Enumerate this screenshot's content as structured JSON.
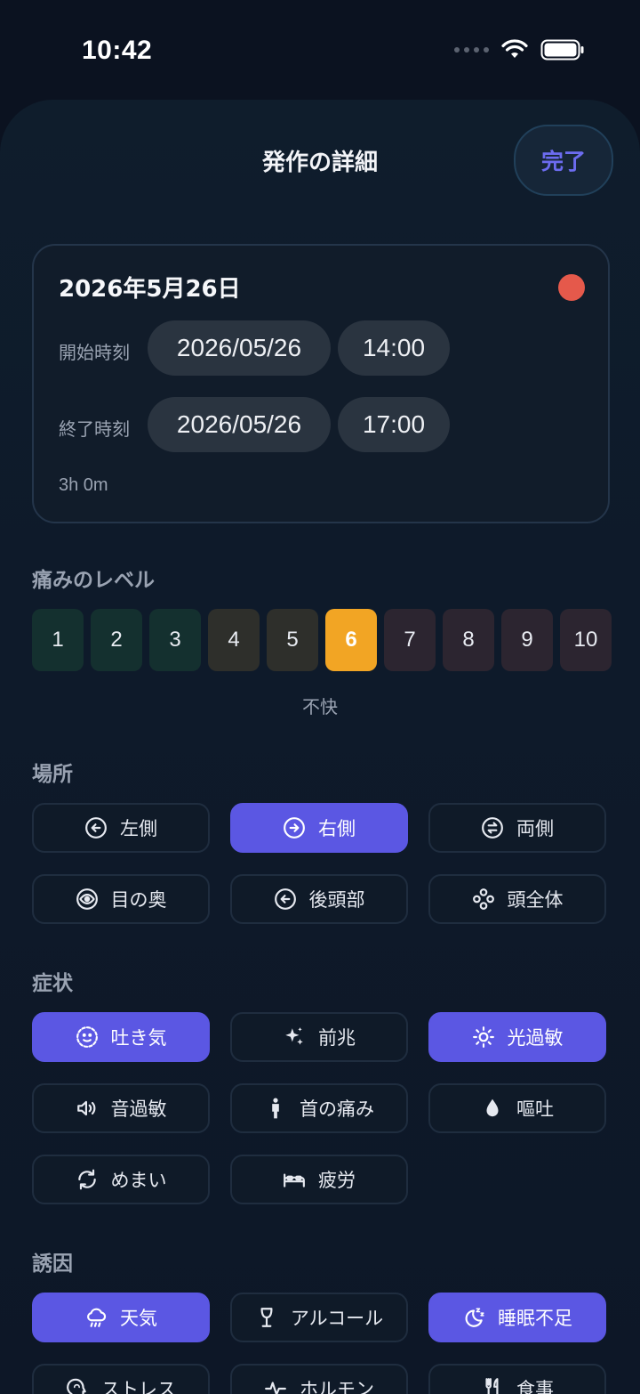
{
  "status_bar": {
    "time": "10:42"
  },
  "header": {
    "title": "発作の詳細",
    "done_label": "完了"
  },
  "episode": {
    "date_title": "2026年5月26日",
    "start_label": "開始時刻",
    "start_date": "2026/05/26",
    "start_time": "14:00",
    "end_label": "終了時刻",
    "end_date": "2026/05/26",
    "end_time": "17:00",
    "duration": "3h 0m",
    "status_color": "#e5594b"
  },
  "pain": {
    "title": "痛みのレベル",
    "levels": [
      {
        "label": "1",
        "color": "#14302f"
      },
      {
        "label": "2",
        "color": "#14302f"
      },
      {
        "label": "3",
        "color": "#14302f"
      },
      {
        "label": "4",
        "color": "#2e2f2b"
      },
      {
        "label": "5",
        "color": "#2e2f2b"
      },
      {
        "label": "6",
        "color": "#f2a524"
      },
      {
        "label": "7",
        "color": "#2c2530"
      },
      {
        "label": "8",
        "color": "#2c2530"
      },
      {
        "label": "9",
        "color": "#2c2530"
      },
      {
        "label": "10",
        "color": "#2c2530"
      }
    ],
    "selected": "6",
    "caption": "不快"
  },
  "location": {
    "title": "場所",
    "items": [
      {
        "label": "左側",
        "icon": "arrow-left-circle-icon",
        "selected": false
      },
      {
        "label": "右側",
        "icon": "arrow-right-circle-icon",
        "selected": true
      },
      {
        "label": "両側",
        "icon": "swap-circle-icon",
        "selected": false
      },
      {
        "label": "目の奥",
        "icon": "eye-icon",
        "selected": false
      },
      {
        "label": "後頭部",
        "icon": "arrow-left-circle-icon",
        "selected": false
      },
      {
        "label": "頭全体",
        "icon": "four-circles-icon",
        "selected": false
      }
    ]
  },
  "symptoms": {
    "title": "症状",
    "items": [
      {
        "label": "吐き気",
        "icon": "nausea-face-icon",
        "selected": true
      },
      {
        "label": "前兆",
        "icon": "sparkles-icon",
        "selected": false
      },
      {
        "label": "光過敏",
        "icon": "sun-icon",
        "selected": true
      },
      {
        "label": "音過敏",
        "icon": "speaker-icon",
        "selected": false
      },
      {
        "label": "首の痛み",
        "icon": "person-icon",
        "selected": false
      },
      {
        "label": "嘔吐",
        "icon": "drop-icon",
        "selected": false
      },
      {
        "label": "めまい",
        "icon": "rotate-icon",
        "selected": false
      },
      {
        "label": "疲労",
        "icon": "bed-icon",
        "selected": false
      }
    ]
  },
  "triggers": {
    "title": "誘因",
    "items": [
      {
        "label": "天気",
        "icon": "cloud-rain-icon",
        "selected": true
      },
      {
        "label": "アルコール",
        "icon": "wine-glass-icon",
        "selected": false
      },
      {
        "label": "睡眠不足",
        "icon": "moon-zzz-icon",
        "selected": true
      },
      {
        "label": "ストレス",
        "icon": "brain-head-icon",
        "selected": false
      },
      {
        "label": "ホルモン",
        "icon": "pulse-icon",
        "selected": false
      },
      {
        "label": "食事",
        "icon": "fork-knife-icon",
        "selected": false
      }
    ]
  }
}
